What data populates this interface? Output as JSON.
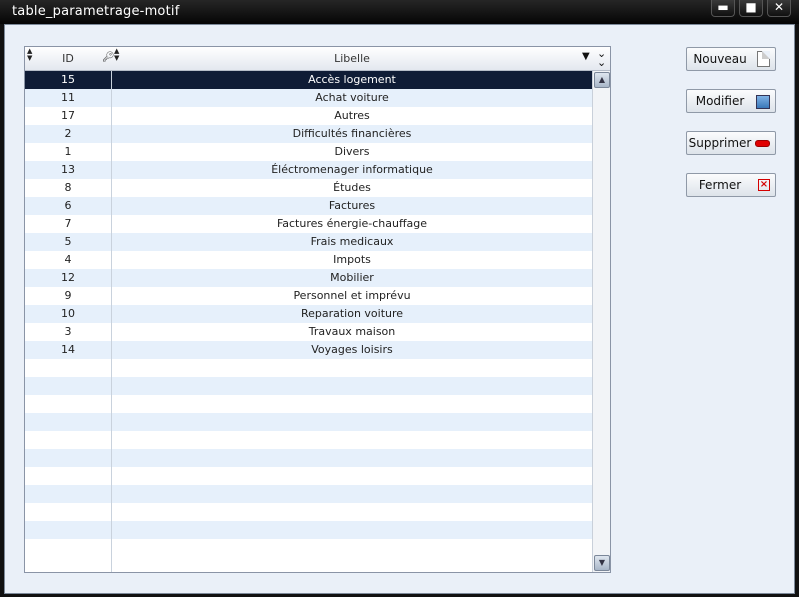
{
  "window": {
    "title": "table_parametrage-motif",
    "controls": {
      "minimize": "▬",
      "maximize": "■",
      "close": "✕"
    }
  },
  "grid": {
    "columns": {
      "id": "ID",
      "libelle": "Libelle"
    },
    "selected_index": 0,
    "rows": [
      {
        "id": "15",
        "libelle": "Accès logement"
      },
      {
        "id": "11",
        "libelle": "Achat voiture"
      },
      {
        "id": "17",
        "libelle": "Autres"
      },
      {
        "id": "2",
        "libelle": "Difficultés financières"
      },
      {
        "id": "1",
        "libelle": "Divers"
      },
      {
        "id": "13",
        "libelle": "Éléctromenager informatique"
      },
      {
        "id": "8",
        "libelle": "Études"
      },
      {
        "id": "6",
        "libelle": "Factures"
      },
      {
        "id": "7",
        "libelle": "Factures énergie-chauffage"
      },
      {
        "id": "5",
        "libelle": "Frais medicaux"
      },
      {
        "id": "4",
        "libelle": "Impots"
      },
      {
        "id": "12",
        "libelle": "Mobilier"
      },
      {
        "id": "9",
        "libelle": "Personnel et imprévu"
      },
      {
        "id": "10",
        "libelle": "Reparation voiture"
      },
      {
        "id": "3",
        "libelle": "Travaux maison"
      },
      {
        "id": "14",
        "libelle": "Voyages loisirs"
      },
      {
        "id": "",
        "libelle": ""
      },
      {
        "id": "",
        "libelle": ""
      },
      {
        "id": "",
        "libelle": ""
      },
      {
        "id": "",
        "libelle": ""
      },
      {
        "id": "",
        "libelle": ""
      },
      {
        "id": "",
        "libelle": ""
      },
      {
        "id": "",
        "libelle": ""
      },
      {
        "id": "",
        "libelle": ""
      },
      {
        "id": "",
        "libelle": ""
      },
      {
        "id": "",
        "libelle": ""
      },
      {
        "id": "",
        "libelle": ""
      }
    ]
  },
  "buttons": {
    "nouveau": {
      "label": "Nouveau",
      "icon": "new-document-icon"
    },
    "modifier": {
      "label": "Modifier",
      "icon": "edit-image-icon"
    },
    "supprimer": {
      "label": "Supprimer",
      "icon": "delete-minus-icon"
    },
    "fermer": {
      "label": "Fermer",
      "icon": "close-x-icon"
    }
  },
  "colors": {
    "selection": "#0f1c36",
    "alt_row": "#e6f0fb",
    "background": "#eaf0f8"
  }
}
